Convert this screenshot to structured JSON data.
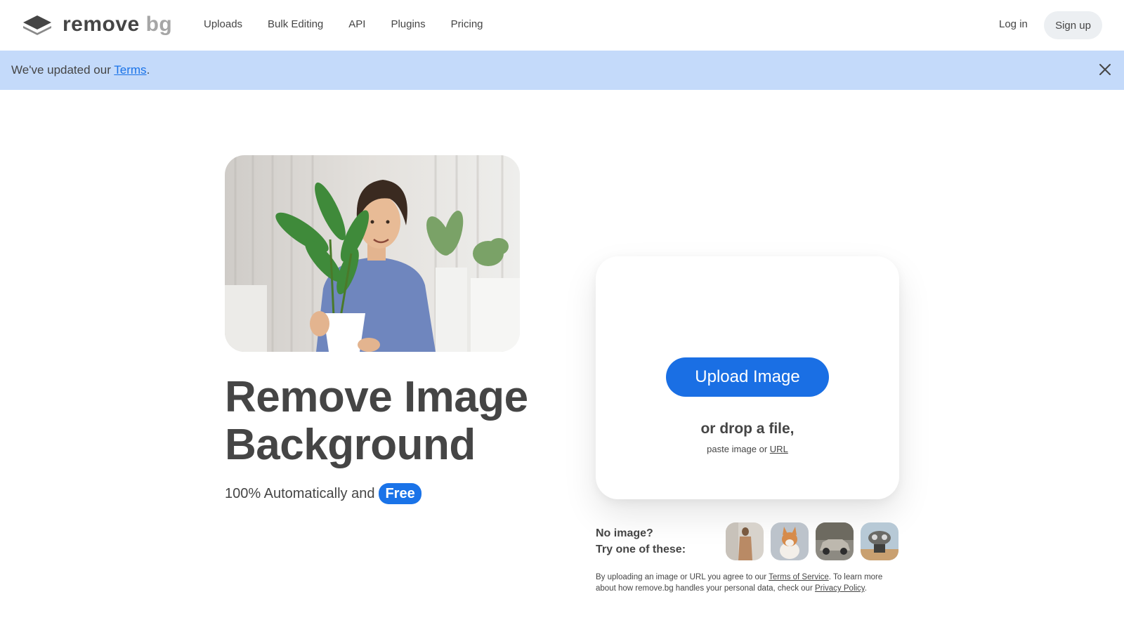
{
  "header": {
    "logo_text_main": "remove",
    "logo_text_bg": "bg",
    "nav": [
      "Uploads",
      "Bulk Editing",
      "API",
      "Plugins",
      "Pricing"
    ],
    "login_label": "Log in",
    "signup_label": "Sign up"
  },
  "banner": {
    "text_before": "We've updated our ",
    "link_text": "Terms",
    "text_after": "."
  },
  "hero": {
    "headline_line1": "Remove Image",
    "headline_line2": "Background",
    "sub_text": "100% Automatically and",
    "free_badge": "Free"
  },
  "upload": {
    "button_label": "Upload Image",
    "drop_text": "or drop a file,",
    "paste_text": "paste image or",
    "url_link": "URL"
  },
  "samples": {
    "line1": "No image?",
    "line2": "Try one of these:",
    "thumbs": [
      "woman-photo",
      "dog-photo",
      "car-photo",
      "robot-photo"
    ]
  },
  "legal": {
    "part1": "By uploading an image or URL you agree to our ",
    "tos_link": "Terms of Service",
    "part2": ". To learn more about how remove.bg handles your personal data, check our ",
    "privacy_link": "Privacy Policy",
    "part3": "."
  },
  "colors": {
    "accent": "#1a73e8",
    "banner_bg": "#c4dafa",
    "text": "#454545"
  }
}
